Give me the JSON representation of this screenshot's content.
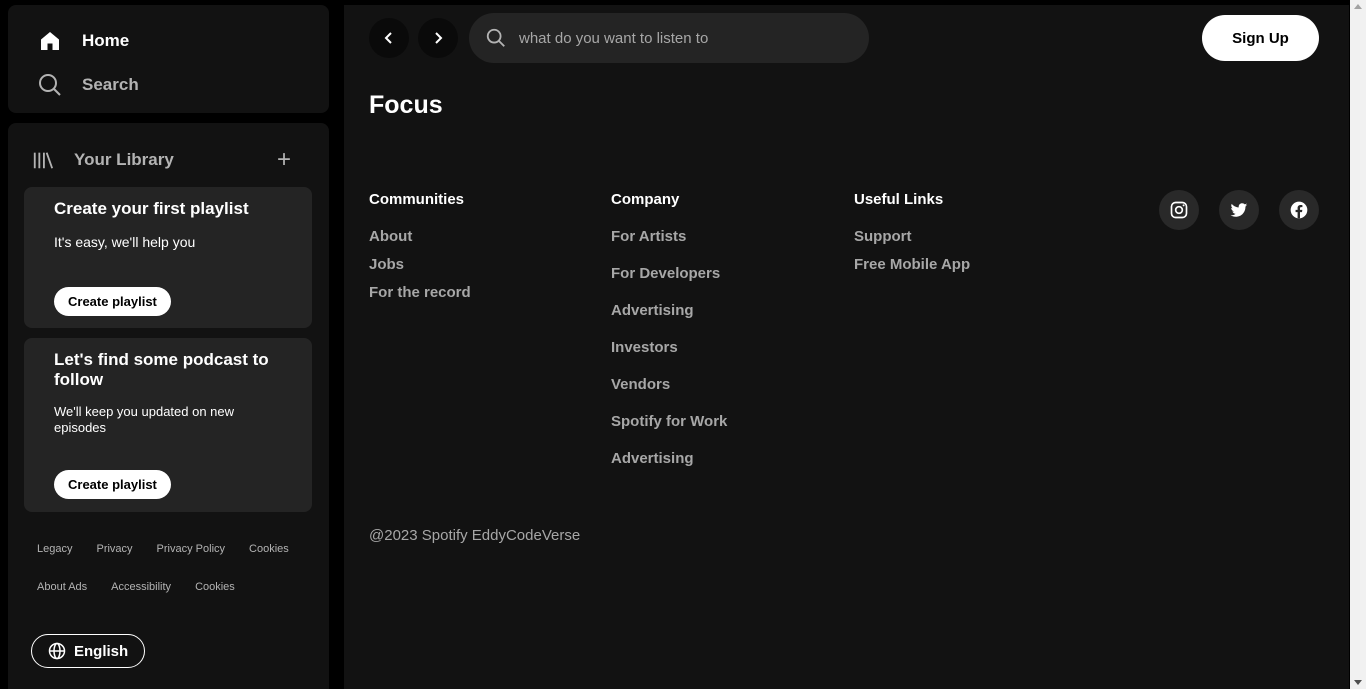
{
  "nav": {
    "home_label": "Home",
    "search_label": "Search"
  },
  "library": {
    "title": "Your Library",
    "add_icon": "plus-icon",
    "promos": [
      {
        "title": "Create your first playlist",
        "subtitle": "It's easy, we'll help you",
        "button": "Create playlist"
      },
      {
        "title": "Let's find some podcast to follow",
        "subtitle": "We'll keep you updated on new episodes",
        "button": "Create playlist"
      }
    ],
    "legal_row_1": [
      "Legacy",
      "Privacy",
      "Privacy Policy",
      "Cookies"
    ],
    "legal_row_2": [
      "About Ads",
      "Accessibility",
      "Cookies"
    ],
    "language_button": "English"
  },
  "topbar": {
    "search_placeholder": "what do you want to listen to",
    "signup_label": "Sign Up"
  },
  "main": {
    "page_title": "Focus",
    "columns": [
      {
        "heading": "Communities",
        "links": [
          "About",
          "Jobs",
          "For the record"
        ]
      },
      {
        "heading": "Company",
        "links": [
          "For Artists",
          "For Developers",
          "Advertising",
          "Investors",
          "Vendors",
          "Spotify for Work",
          "Advertising"
        ]
      },
      {
        "heading": "Useful Links",
        "links": [
          "Support",
          "Free Mobile App"
        ]
      }
    ],
    "social_icons": [
      "instagram-icon",
      "twitter-icon",
      "facebook-icon"
    ],
    "copyright": "@2023 Spotify EddyCodeVerse"
  },
  "colors": {
    "background": "#000000",
    "panel": "#121212",
    "card": "#242424",
    "muted_text": "#a7a7a7"
  }
}
